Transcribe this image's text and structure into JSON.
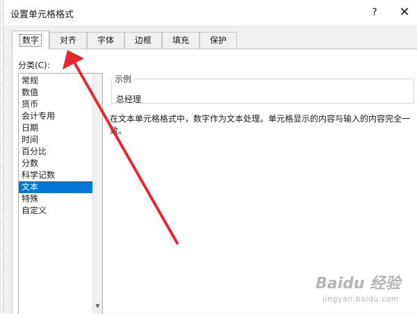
{
  "dialog": {
    "title": "设置单元格格式",
    "help_label": "?",
    "close_label": "✕"
  },
  "tabs": [
    {
      "label": "数字",
      "active": true
    },
    {
      "label": "对齐",
      "active": false
    },
    {
      "label": "字体",
      "active": false
    },
    {
      "label": "边框",
      "active": false
    },
    {
      "label": "填充",
      "active": false
    },
    {
      "label": "保护",
      "active": false
    }
  ],
  "category": {
    "label": "分类(C):",
    "items": [
      "常规",
      "数值",
      "货币",
      "会计专用",
      "日期",
      "时间",
      "百分比",
      "分数",
      "科学记数",
      "文本",
      "特殊",
      "自定义"
    ],
    "selected": "文本"
  },
  "sample": {
    "legend": "示例",
    "value": "总经理"
  },
  "description": "在文本单元格格式中，数字作为文本处理。单元格显示的内容与输入的内容完全一致。",
  "annotation": {
    "color": "#e8262d"
  },
  "watermark": {
    "logo": "Baidu 经验",
    "sub": "jingyan.baidu.com"
  },
  "icons": {
    "scroll_down": "chevron-down-icon"
  }
}
